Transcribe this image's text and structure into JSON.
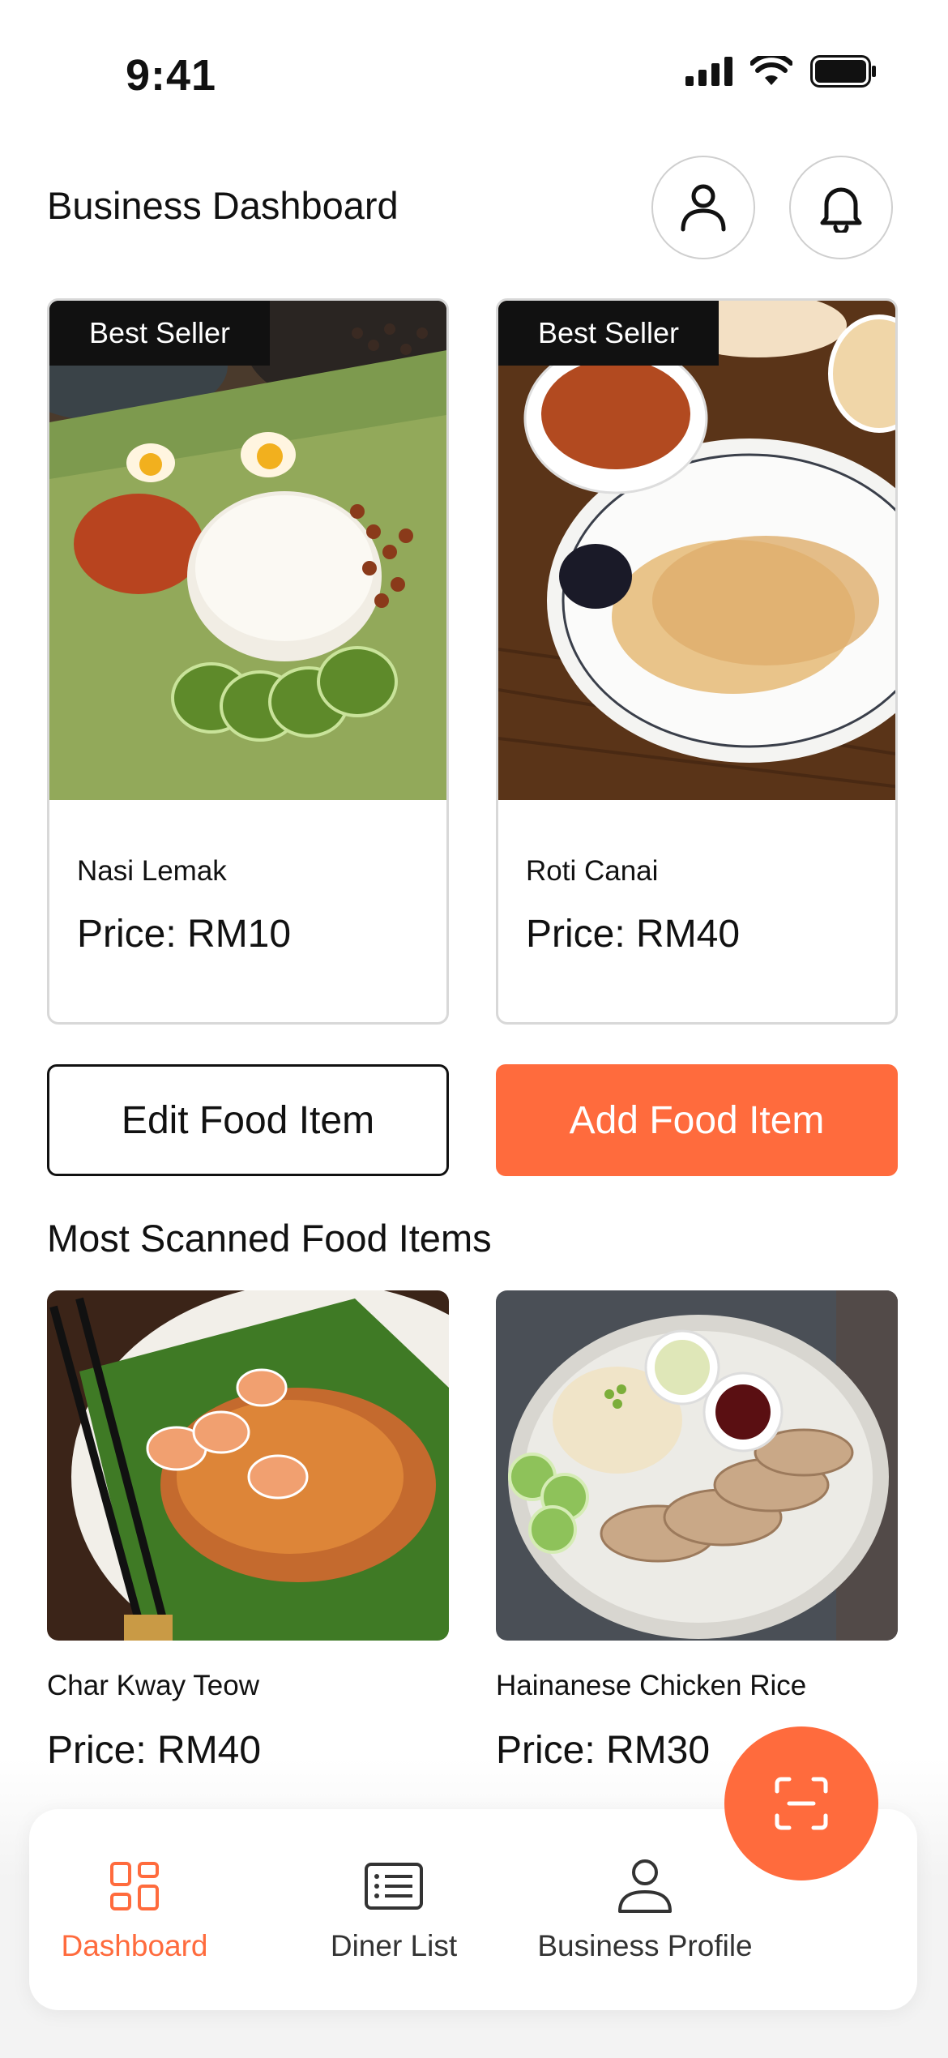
{
  "status": {
    "time": "9:41"
  },
  "header": {
    "title": "Business Dashboard"
  },
  "featured": [
    {
      "badge": "Best Seller",
      "name": "Nasi Lemak",
      "price": "Price: RM10"
    },
    {
      "badge": "Best Seller",
      "name": "Roti Canai",
      "price": "Price: RM40"
    }
  ],
  "actions": {
    "edit_label": "Edit Food Item",
    "add_label": "Add Food Item"
  },
  "most_scanned": {
    "title": "Most Scanned Food Items",
    "items": [
      {
        "name": "Char Kway Teow",
        "price": "Price: RM40"
      },
      {
        "name": "Hainanese Chicken Rice",
        "price": "Price: RM30"
      }
    ]
  },
  "nav": {
    "items": [
      {
        "label": "Dashboard",
        "icon": "grid-icon"
      },
      {
        "label": "Diner List",
        "icon": "list-icon"
      },
      {
        "label": "Business Profile",
        "icon": "person-icon"
      }
    ]
  },
  "colors": {
    "accent": "#ff6b3d",
    "text": "#111111",
    "border": "#d8d8d8"
  }
}
